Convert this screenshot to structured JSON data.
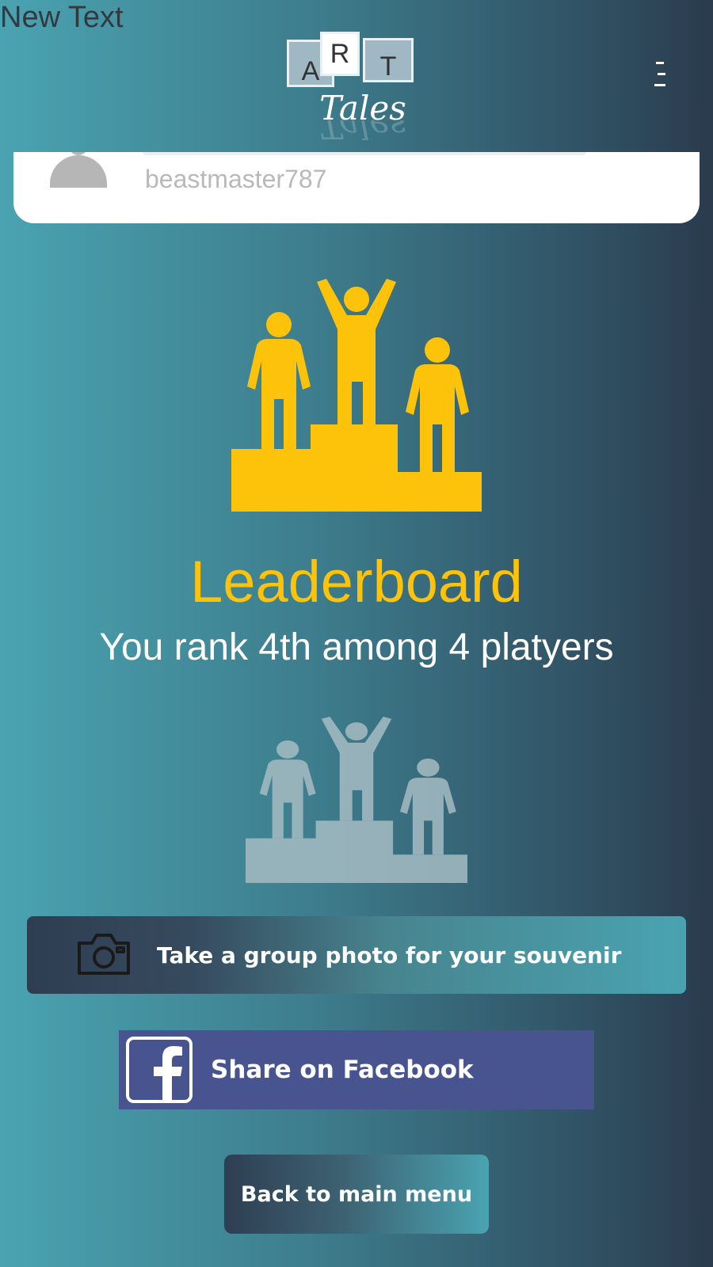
{
  "debug_label": "New Text",
  "header": {
    "logo": {
      "letters": [
        "A",
        "R",
        "T"
      ],
      "script_word": "Tales"
    },
    "menu_icon": "hamburger-menu-icon"
  },
  "profile": {
    "username": "beastmaster787",
    "avatar_icon": "user-silhouette-icon"
  },
  "leaderboard": {
    "icon": "podium-winners-icon",
    "title": "Leaderboard",
    "rank_text": "You rank 4th among 4 platyers",
    "secondary_icon": "podium-winners-icon",
    "title_color": "#fdc20a"
  },
  "actions": {
    "photo_label": "Take a group photo for your souvenir",
    "photo_icon": "camera-icon",
    "facebook_label": "Share on Facebook",
    "facebook_icon": "facebook-icon",
    "facebook_color": "#475490",
    "back_label": "Back to main menu"
  }
}
